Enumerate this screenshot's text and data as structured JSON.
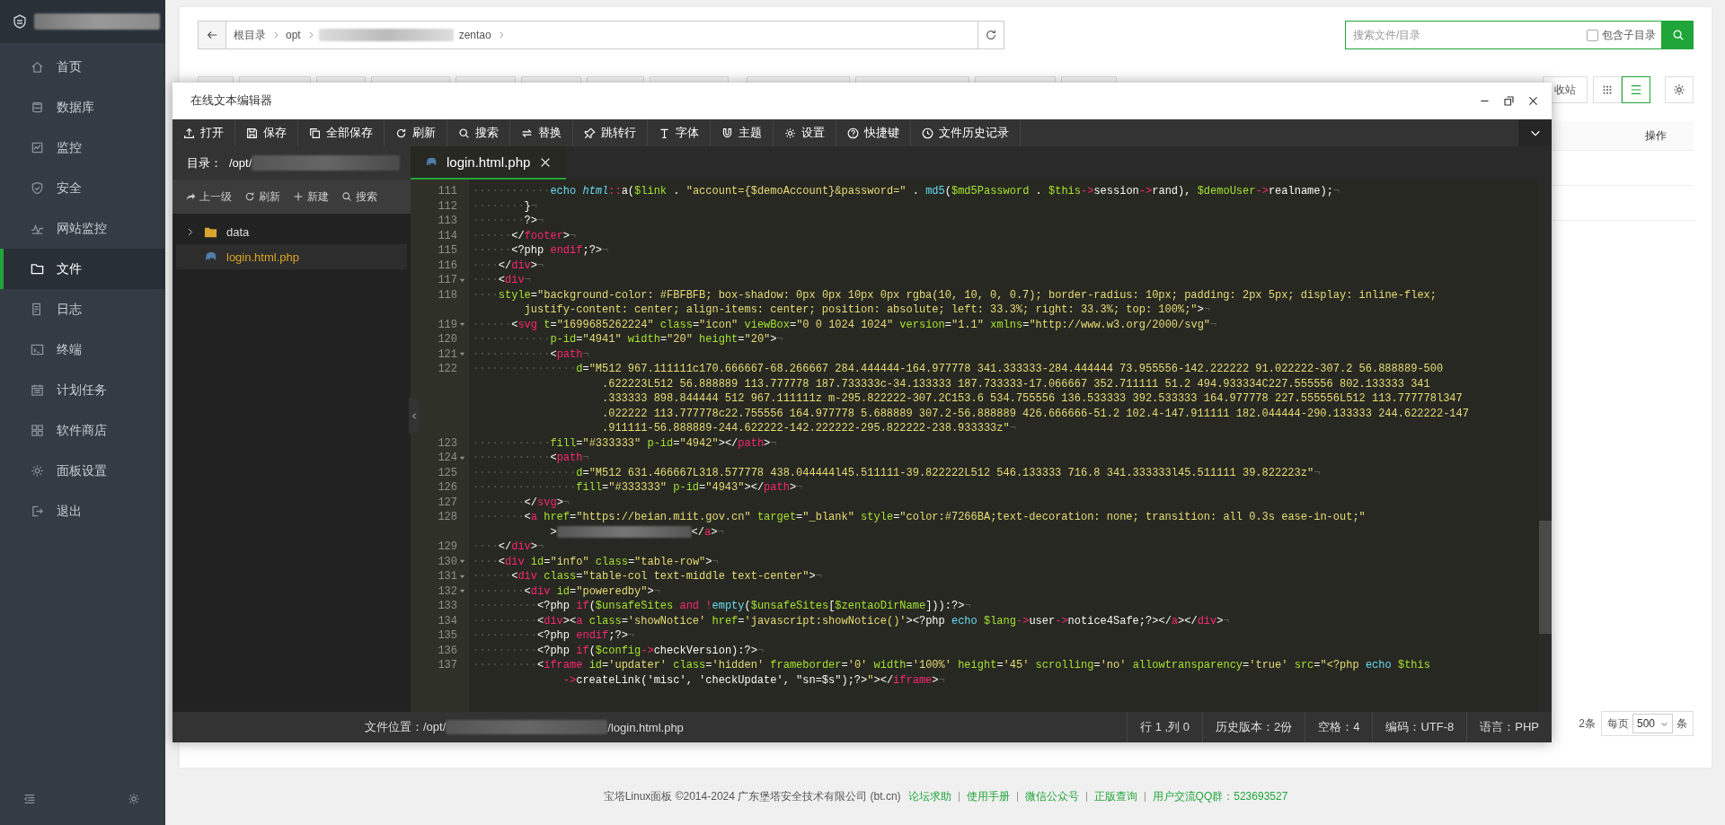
{
  "sidebar": {
    "items": [
      {
        "label": "首页",
        "selected": false
      },
      {
        "label": "数据库",
        "selected": false
      },
      {
        "label": "监控",
        "selected": false
      },
      {
        "label": "安全",
        "selected": false
      },
      {
        "label": "网站监控",
        "selected": false
      },
      {
        "label": "文件",
        "selected": true
      },
      {
        "label": "日志",
        "selected": false
      },
      {
        "label": "终端",
        "selected": false
      },
      {
        "label": "计划任务",
        "selected": false
      },
      {
        "label": "软件商店",
        "selected": false
      },
      {
        "label": "面板设置",
        "selected": false
      },
      {
        "label": "退出",
        "selected": false
      }
    ]
  },
  "path_bar": {
    "segments": [
      {
        "kind": "text",
        "label": "根目录"
      },
      {
        "kind": "text",
        "label": "opt"
      },
      {
        "kind": "redacted"
      },
      {
        "kind": "text",
        "label": "zentao"
      }
    ]
  },
  "search": {
    "placeholder": "搜索文件/目录",
    "include_subdirs": {
      "label": "包含子目录",
      "checked": false
    }
  },
  "toolbar": {
    "recycle_bin": "收站",
    "view_modes": [
      {
        "selected": false
      },
      {
        "selected": true
      }
    ]
  },
  "table": {
    "columns": [
      "操作"
    ]
  },
  "pagination": {
    "total": "2条",
    "per_page_label": "每页",
    "per_page": "500",
    "unit": "条"
  },
  "editor": {
    "title": "在线文本编辑器",
    "toolbar": [
      "打开",
      "保存",
      "全部保存",
      "刷新",
      "搜索",
      "替换",
      "跳转行",
      "字体",
      "主题",
      "设置",
      "快捷键",
      "文件历史记录"
    ],
    "directory": {
      "label": "目录：",
      "path": "/opt/"
    },
    "file_actions": [
      "上一级",
      "刷新",
      "新建",
      "搜索"
    ],
    "tree": [
      {
        "kind": "folder",
        "name": "data",
        "expanded": false,
        "selected": false
      },
      {
        "kind": "file",
        "name": "login.html.php",
        "selected": true
      }
    ],
    "tabs": [
      {
        "label": "login.html.php",
        "selected": true
      }
    ],
    "lines": [
      {
        "number": "111",
        "fold": false,
        "indent": "············",
        "rows": [
          {
            "tokens": [
              {
                "kind": "func",
                "text": "echo "
              },
              {
                "kind": "class",
                "text": "html"
              },
              {
                "kind": "keyword",
                "text": "::"
              },
              {
                "kind": "plain",
                "text": "a("
              },
              {
                "kind": "var",
                "text": "$link"
              },
              {
                "kind": "plain",
                "text": " . "
              },
              {
                "kind": "string",
                "text": "\"account={$demoAccount}&password=\""
              },
              {
                "kind": "plain",
                "text": " . "
              },
              {
                "kind": "func",
                "text": "md5"
              },
              {
                "kind": "plain",
                "text": "("
              },
              {
                "kind": "var",
                "text": "$md5Password"
              },
              {
                "kind": "plain",
                "text": " . "
              },
              {
                "kind": "var",
                "text": "$this"
              },
              {
                "kind": "keyword",
                "text": "->"
              },
              {
                "kind": "plain",
                "text": "session"
              },
              {
                "kind": "keyword",
                "text": "->"
              },
              {
                "kind": "plain",
                "text": "rand), "
              },
              {
                "kind": "var",
                "text": "$demoUser"
              },
              {
                "kind": "keyword",
                "text": "->"
              },
              {
                "kind": "plain",
                "text": "realname);"
              },
              {
                "kind": "eol",
                "text": "¬"
              }
            ]
          }
        ]
      },
      {
        "number": "112",
        "fold": false,
        "indent": "········",
        "rows": [
          {
            "tokens": [
              {
                "kind": "plain",
                "text": "}"
              },
              {
                "kind": "eol",
                "text": "¬"
              }
            ]
          }
        ]
      },
      {
        "number": "113",
        "fold": false,
        "indent": "········",
        "rows": [
          {
            "tokens": [
              {
                "kind": "plain",
                "text": "?>"
              },
              {
                "kind": "eol",
                "text": "¬"
              }
            ]
          }
        ]
      },
      {
        "number": "114",
        "fold": false,
        "indent": "······",
        "rows": [
          {
            "tokens": [
              {
                "kind": "plain",
                "text": "</"
              },
              {
                "kind": "tag",
                "text": "footer"
              },
              {
                "kind": "plain",
                "text": ">"
              },
              {
                "kind": "eol",
                "text": "¬"
              }
            ]
          }
        ]
      },
      {
        "number": "115",
        "fold": false,
        "indent": "······",
        "rows": [
          {
            "tokens": [
              {
                "kind": "plain",
                "text": "<?php "
              },
              {
                "kind": "keyword",
                "text": "endif"
              },
              {
                "kind": "plain",
                "text": ";?>"
              },
              {
                "kind": "eol",
                "text": "¬"
              }
            ]
          }
        ]
      },
      {
        "number": "116",
        "fold": false,
        "indent": "····",
        "rows": [
          {
            "tokens": [
              {
                "kind": "plain",
                "text": "</"
              },
              {
                "kind": "tag",
                "text": "div"
              },
              {
                "kind": "plain",
                "text": ">"
              },
              {
                "kind": "eol",
                "text": "¬"
              }
            ]
          }
        ]
      },
      {
        "number": "117",
        "fold": true,
        "indent": "····",
        "rows": [
          {
            "tokens": [
              {
                "kind": "plain",
                "text": "<"
              },
              {
                "kind": "tag",
                "text": "div"
              },
              {
                "kind": "eol",
                "text": "¬"
              }
            ]
          }
        ]
      },
      {
        "number": "118",
        "fold": false,
        "indent": "····",
        "rows": [
          {
            "tokens": [
              {
                "kind": "attr",
                "text": "style"
              },
              {
                "kind": "plain",
                "text": "="
              },
              {
                "kind": "string",
                "text": "\"background-color: #FBFBFB; box-shadow: 0px 0px 10px 0px rgba(10, 10, 0, 0.7); border-radius: 10px; padding: 2px 5px; display: inline-flex;"
              }
            ]
          },
          {
            "tokens": [
              {
                "kind": "string",
                "text": "justify-content: center; align-items: center; position: absolute; left: 33.3%; right: 33.3%; top: 100%;\""
              },
              {
                "kind": "plain",
                "text": ">"
              },
              {
                "kind": "eol",
                "text": "¬"
              }
            ]
          }
        ]
      },
      {
        "number": "119",
        "fold": true,
        "indent": "······",
        "rows": [
          {
            "tokens": [
              {
                "kind": "plain",
                "text": "<"
              },
              {
                "kind": "tag",
                "text": "svg "
              },
              {
                "kind": "attr",
                "text": "t"
              },
              {
                "kind": "plain",
                "text": "="
              },
              {
                "kind": "string",
                "text": "\"1699685262224\" "
              },
              {
                "kind": "attr",
                "text": "class"
              },
              {
                "kind": "plain",
                "text": "="
              },
              {
                "kind": "string",
                "text": "\"icon\" "
              },
              {
                "kind": "attr",
                "text": "viewBox"
              },
              {
                "kind": "plain",
                "text": "="
              },
              {
                "kind": "string",
                "text": "\"0 0 1024 1024\" "
              },
              {
                "kind": "attr",
                "text": "version"
              },
              {
                "kind": "plain",
                "text": "="
              },
              {
                "kind": "string",
                "text": "\"1.1\" "
              },
              {
                "kind": "attr",
                "text": "xmlns"
              },
              {
                "kind": "plain",
                "text": "="
              },
              {
                "kind": "string",
                "text": "\"http://www.w3.org/2000/svg\""
              },
              {
                "kind": "eol",
                "text": "¬"
              }
            ]
          }
        ]
      },
      {
        "number": "120",
        "fold": false,
        "indent": "············",
        "rows": [
          {
            "tokens": [
              {
                "kind": "attr",
                "text": "p-id"
              },
              {
                "kind": "plain",
                "text": "="
              },
              {
                "kind": "string",
                "text": "\"4941\" "
              },
              {
                "kind": "attr",
                "text": "width"
              },
              {
                "kind": "plain",
                "text": "="
              },
              {
                "kind": "string",
                "text": "\"20\" "
              },
              {
                "kind": "attr",
                "text": "height"
              },
              {
                "kind": "plain",
                "text": "="
              },
              {
                "kind": "string",
                "text": "\"20\""
              },
              {
                "kind": "plain",
                "text": ">"
              },
              {
                "kind": "eol",
                "text": "¬"
              }
            ]
          }
        ]
      },
      {
        "number": "121",
        "fold": true,
        "indent": "············",
        "rows": [
          {
            "tokens": [
              {
                "kind": "plain",
                "text": "<"
              },
              {
                "kind": "tag",
                "text": "path"
              },
              {
                "kind": "eol",
                "text": "¬"
              }
            ]
          }
        ]
      },
      {
        "number": "122",
        "fold": false,
        "indent": "················",
        "rows": [
          {
            "tokens": [
              {
                "kind": "attr",
                "text": "d"
              },
              {
                "kind": "plain",
                "text": "="
              },
              {
                "kind": "string",
                "text": "\"M512 967.111111c170.666667-68.266667 284.444444-164.977778 341.333333-284.444444 73.955556-142.222222 91.022222-307.2 56.888889-500"
              }
            ]
          },
          {
            "tokens": [
              {
                "kind": "string",
                "text": ".622223L512 56.888889 113.777778 187.733333c-34.133333 187.733333-17.066667 352.711111 51.2 494.933334C227.555556 802.133333 341"
              }
            ]
          },
          {
            "tokens": [
              {
                "kind": "string",
                "text": ".333333 898.844444 512 967.111111z m-295.822222-307.2C153.6 534.755556 136.533333 392.533333 164.977778 227.555556L512 113.777778l347"
              }
            ]
          },
          {
            "tokens": [
              {
                "kind": "string",
                "text": ".022222 113.777778c22.755556 164.977778 5.688889 307.2-56.888889 426.666666-51.2 102.4-147.911111 182.044444-290.133333 244.622222-147"
              }
            ]
          },
          {
            "tokens": [
              {
                "kind": "string",
                "text": ".911111-56.888889-244.622222-142.222222-295.822222-238.933333z\""
              },
              {
                "kind": "eol",
                "text": "¬"
              }
            ]
          }
        ]
      },
      {
        "number": "123",
        "fold": false,
        "indent": "············",
        "rows": [
          {
            "tokens": [
              {
                "kind": "attr",
                "text": "fill"
              },
              {
                "kind": "plain",
                "text": "="
              },
              {
                "kind": "string",
                "text": "\"#333333\" "
              },
              {
                "kind": "attr",
                "text": "p-id"
              },
              {
                "kind": "plain",
                "text": "="
              },
              {
                "kind": "string",
                "text": "\"4942\""
              },
              {
                "kind": "plain",
                "text": "></"
              },
              {
                "kind": "tag",
                "text": "path"
              },
              {
                "kind": "plain",
                "text": ">"
              },
              {
                "kind": "eol",
                "text": "¬"
              }
            ]
          }
        ]
      },
      {
        "number": "124",
        "fold": true,
        "indent": "············",
        "rows": [
          {
            "tokens": [
              {
                "kind": "plain",
                "text": "<"
              },
              {
                "kind": "tag",
                "text": "path"
              },
              {
                "kind": "eol",
                "text": "¬"
              }
            ]
          }
        ]
      },
      {
        "number": "125",
        "fold": false,
        "indent": "················",
        "rows": [
          {
            "tokens": [
              {
                "kind": "attr",
                "text": "d"
              },
              {
                "kind": "plain",
                "text": "="
              },
              {
                "kind": "string",
                "text": "\"M512 631.466667L318.577778 438.044444l45.511111-39.822222L512 546.133333 716.8 341.333333l45.511111 39.822223z\""
              },
              {
                "kind": "eol",
                "text": "¬"
              }
            ]
          }
        ]
      },
      {
        "number": "126",
        "fold": false,
        "indent": "················",
        "rows": [
          {
            "tokens": [
              {
                "kind": "attr",
                "text": "fill"
              },
              {
                "kind": "plain",
                "text": "="
              },
              {
                "kind": "string",
                "text": "\"#333333\" "
              },
              {
                "kind": "attr",
                "text": "p-id"
              },
              {
                "kind": "plain",
                "text": "="
              },
              {
                "kind": "string",
                "text": "\"4943\""
              },
              {
                "kind": "plain",
                "text": "></"
              },
              {
                "kind": "tag",
                "text": "path"
              },
              {
                "kind": "plain",
                "text": ">"
              },
              {
                "kind": "eol",
                "text": "¬"
              }
            ]
          }
        ]
      },
      {
        "number": "127",
        "fold": false,
        "indent": "········",
        "rows": [
          {
            "tokens": [
              {
                "kind": "plain",
                "text": "</"
              },
              {
                "kind": "tag",
                "text": "svg"
              },
              {
                "kind": "plain",
                "text": ">"
              },
              {
                "kind": "eol",
                "text": "¬"
              }
            ]
          }
        ]
      },
      {
        "number": "128",
        "fold": false,
        "indent": "········",
        "rows": [
          {
            "tokens": [
              {
                "kind": "plain",
                "text": "<"
              },
              {
                "kind": "tag",
                "text": "a "
              },
              {
                "kind": "attr",
                "text": "href"
              },
              {
                "kind": "plain",
                "text": "="
              },
              {
                "kind": "string",
                "text": "\"https://beian.miit.gov.cn\" "
              },
              {
                "kind": "attr",
                "text": "target"
              },
              {
                "kind": "plain",
                "text": "="
              },
              {
                "kind": "string",
                "text": "\"_blank\" "
              },
              {
                "kind": "attr",
                "text": "style"
              },
              {
                "kind": "plain",
                "text": "="
              },
              {
                "kind": "string",
                "text": "\"color:#7266BA;text-decoration: none; transition: all 0.3s ease-in-out;\""
              }
            ]
          },
          {
            "tokens": [
              {
                "kind": "plain",
                "text": ">"
              },
              {
                "kind": "redacted"
              },
              {
                "kind": "plain",
                "text": "</"
              },
              {
                "kind": "tag",
                "text": "a"
              },
              {
                "kind": "plain",
                "text": ">"
              },
              {
                "kind": "eol",
                "text": "¬"
              }
            ]
          }
        ]
      },
      {
        "number": "129",
        "fold": false,
        "indent": "····",
        "rows": [
          {
            "tokens": [
              {
                "kind": "plain",
                "text": "</"
              },
              {
                "kind": "tag",
                "text": "div"
              },
              {
                "kind": "plain",
                "text": ">"
              },
              {
                "kind": "eol",
                "text": "¬"
              }
            ]
          }
        ]
      },
      {
        "number": "130",
        "fold": true,
        "indent": "····",
        "rows": [
          {
            "tokens": [
              {
                "kind": "plain",
                "text": "<"
              },
              {
                "kind": "tag",
                "text": "div "
              },
              {
                "kind": "attr",
                "text": "id"
              },
              {
                "kind": "plain",
                "text": "="
              },
              {
                "kind": "string",
                "text": "\"info\" "
              },
              {
                "kind": "attr",
                "text": "class"
              },
              {
                "kind": "plain",
                "text": "="
              },
              {
                "kind": "string",
                "text": "\"table-row\""
              },
              {
                "kind": "plain",
                "text": ">"
              },
              {
                "kind": "eol",
                "text": "¬"
              }
            ]
          }
        ]
      },
      {
        "number": "131",
        "fold": true,
        "indent": "······",
        "rows": [
          {
            "tokens": [
              {
                "kind": "plain",
                "text": "<"
              },
              {
                "kind": "tag",
                "text": "div "
              },
              {
                "kind": "attr",
                "text": "class"
              },
              {
                "kind": "plain",
                "text": "="
              },
              {
                "kind": "string",
                "text": "\"table-col text-middle text-center\""
              },
              {
                "kind": "plain",
                "text": ">"
              },
              {
                "kind": "eol",
                "text": "¬"
              }
            ]
          }
        ]
      },
      {
        "number": "132",
        "fold": true,
        "indent": "········",
        "rows": [
          {
            "tokens": [
              {
                "kind": "plain",
                "text": "<"
              },
              {
                "kind": "tag",
                "text": "div "
              },
              {
                "kind": "attr",
                "text": "id"
              },
              {
                "kind": "plain",
                "text": "="
              },
              {
                "kind": "string",
                "text": "\"poweredby\""
              },
              {
                "kind": "plain",
                "text": ">"
              },
              {
                "kind": "eol",
                "text": "¬"
              }
            ]
          }
        ]
      },
      {
        "number": "133",
        "fold": false,
        "indent": "··········",
        "rows": [
          {
            "tokens": [
              {
                "kind": "plain",
                "text": "<?php "
              },
              {
                "kind": "keyword",
                "text": "if"
              },
              {
                "kind": "plain",
                "text": "("
              },
              {
                "kind": "var",
                "text": "$unsafeSites "
              },
              {
                "kind": "keyword",
                "text": "and !"
              },
              {
                "kind": "func",
                "text": "empty"
              },
              {
                "kind": "plain",
                "text": "("
              },
              {
                "kind": "var",
                "text": "$unsafeSites"
              },
              {
                "kind": "plain",
                "text": "["
              },
              {
                "kind": "var",
                "text": "$zentaoDirName"
              },
              {
                "kind": "plain",
                "text": "])):?>"
              },
              {
                "kind": "eol",
                "text": "¬"
              }
            ]
          }
        ]
      },
      {
        "number": "134",
        "fold": false,
        "indent": "··········",
        "rows": [
          {
            "tokens": [
              {
                "kind": "plain",
                "text": "<"
              },
              {
                "kind": "tag",
                "text": "div"
              },
              {
                "kind": "plain",
                "text": "><"
              },
              {
                "kind": "tag",
                "text": "a "
              },
              {
                "kind": "attr",
                "text": "class"
              },
              {
                "kind": "plain",
                "text": "="
              },
              {
                "kind": "string",
                "text": "'showNotice' "
              },
              {
                "kind": "attr",
                "text": "href"
              },
              {
                "kind": "plain",
                "text": "="
              },
              {
                "kind": "string",
                "text": "'javascript:showNotice()'"
              },
              {
                "kind": "plain",
                "text": "><?php "
              },
              {
                "kind": "func",
                "text": "echo "
              },
              {
                "kind": "var",
                "text": "$lang"
              },
              {
                "kind": "keyword",
                "text": "->"
              },
              {
                "kind": "plain",
                "text": "user"
              },
              {
                "kind": "keyword",
                "text": "->"
              },
              {
                "kind": "plain",
                "text": "notice4Safe;?></"
              },
              {
                "kind": "tag",
                "text": "a"
              },
              {
                "kind": "plain",
                "text": "></"
              },
              {
                "kind": "tag",
                "text": "div"
              },
              {
                "kind": "plain",
                "text": ">"
              },
              {
                "kind": "eol",
                "text": "¬"
              }
            ]
          }
        ]
      },
      {
        "number": "135",
        "fold": false,
        "indent": "··········",
        "rows": [
          {
            "tokens": [
              {
                "kind": "plain",
                "text": "<?php "
              },
              {
                "kind": "keyword",
                "text": "endif"
              },
              {
                "kind": "plain",
                "text": ";?>"
              },
              {
                "kind": "eol",
                "text": "¬"
              }
            ]
          }
        ]
      },
      {
        "number": "136",
        "fold": false,
        "indent": "··········",
        "rows": [
          {
            "tokens": [
              {
                "kind": "plain",
                "text": "<?php "
              },
              {
                "kind": "keyword",
                "text": "if"
              },
              {
                "kind": "plain",
                "text": "("
              },
              {
                "kind": "var",
                "text": "$config"
              },
              {
                "kind": "keyword",
                "text": "->"
              },
              {
                "kind": "plain",
                "text": "checkVersion):?>"
              },
              {
                "kind": "eol",
                "text": "¬"
              }
            ]
          }
        ]
      },
      {
        "number": "137",
        "fold": false,
        "indent": "··········",
        "rows": [
          {
            "tokens": [
              {
                "kind": "plain",
                "text": "<"
              },
              {
                "kind": "tag",
                "text": "iframe "
              },
              {
                "kind": "attr",
                "text": "id"
              },
              {
                "kind": "plain",
                "text": "="
              },
              {
                "kind": "string",
                "text": "'updater' "
              },
              {
                "kind": "attr",
                "text": "class"
              },
              {
                "kind": "plain",
                "text": "="
              },
              {
                "kind": "string",
                "text": "'hidden' "
              },
              {
                "kind": "attr",
                "text": "frameborder"
              },
              {
                "kind": "plain",
                "text": "="
              },
              {
                "kind": "string",
                "text": "'0' "
              },
              {
                "kind": "attr",
                "text": "width"
              },
              {
                "kind": "plain",
                "text": "="
              },
              {
                "kind": "string",
                "text": "'100%' "
              },
              {
                "kind": "attr",
                "text": "height"
              },
              {
                "kind": "plain",
                "text": "="
              },
              {
                "kind": "string",
                "text": "'45' "
              },
              {
                "kind": "attr",
                "text": "scrolling"
              },
              {
                "kind": "plain",
                "text": "="
              },
              {
                "kind": "string",
                "text": "'no' "
              },
              {
                "kind": "attr",
                "text": "allowtransparency"
              },
              {
                "kind": "plain",
                "text": "="
              },
              {
                "kind": "string",
                "text": "'true' "
              },
              {
                "kind": "attr",
                "text": "src"
              },
              {
                "kind": "plain",
                "text": "="
              },
              {
                "kind": "string",
                "text": "\"<?php "
              },
              {
                "kind": "func",
                "text": "echo "
              },
              {
                "kind": "var",
                "text": "$this"
              }
            ]
          },
          {
            "tokens": [
              {
                "kind": "keyword",
                "text": "->"
              },
              {
                "kind": "plain",
                "text": "createLink('misc', 'checkUpdate', \"sn=$s\");?>"
              },
              {
                "kind": "string",
                "text": "\""
              },
              {
                "kind": "plain",
                "text": "></"
              },
              {
                "kind": "tag",
                "text": "iframe"
              },
              {
                "kind": "plain",
                "text": ">"
              },
              {
                "kind": "eol",
                "text": "¬"
              }
            ]
          }
        ]
      }
    ],
    "status": {
      "path_prefix": "文件位置：/opt/",
      "path_suffix": "/login.html.php",
      "items": [
        "行 1 ,列 0",
        "历史版本：2份",
        "空格：4",
        "编码：UTF-8",
        "语言：PHP"
      ]
    }
  },
  "footer": {
    "copyright": "宝塔Linux面板 ©2014-2024 广东堡塔安全技术有限公司 (bt.cn)",
    "links": [
      "论坛求助",
      "使用手册",
      "微信公众号",
      "正版查询",
      "用户交流QQ群：523693527"
    ]
  }
}
